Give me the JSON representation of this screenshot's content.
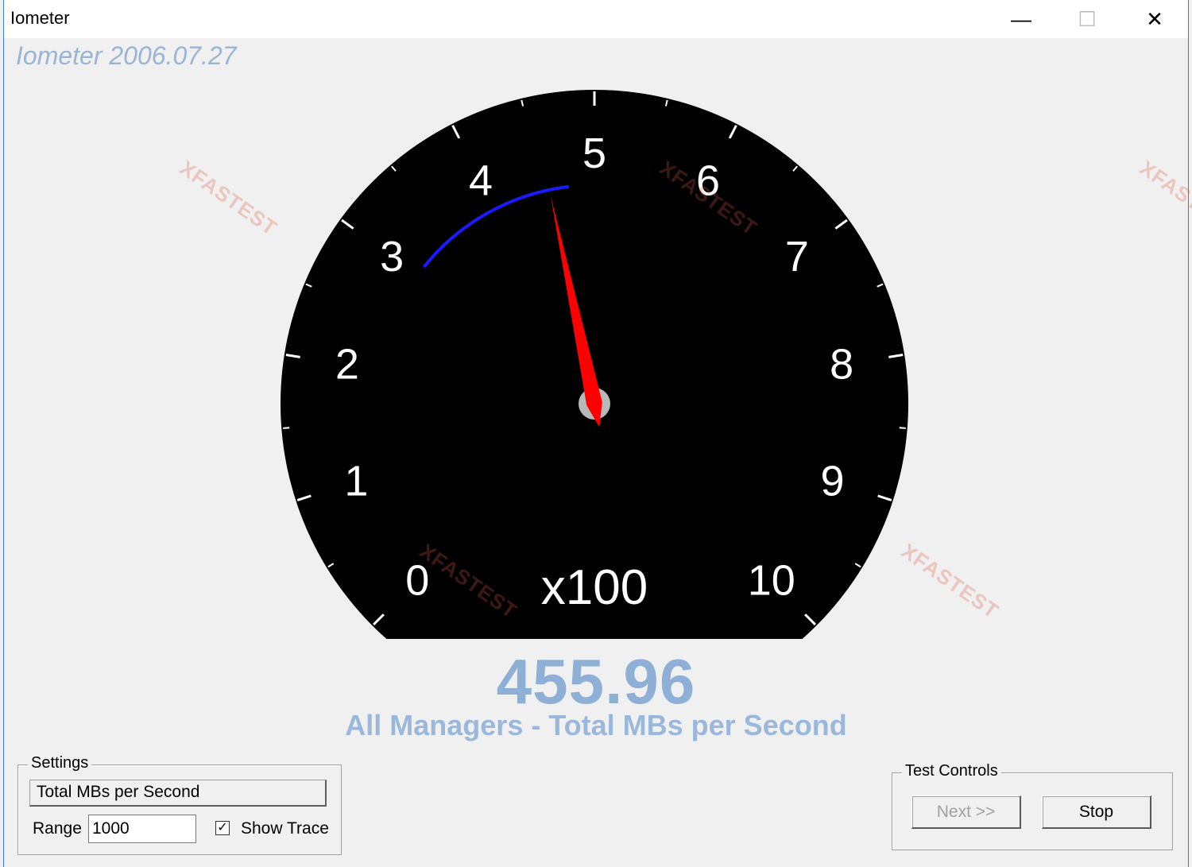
{
  "window": {
    "title": "Iometer",
    "minimize_icon": "minimize-icon",
    "maximize_icon": "maximize-icon",
    "close_icon": "close-icon",
    "minimize_glyph": "—",
    "maximize_glyph": "☐",
    "close_glyph": "✕"
  },
  "app_version": "Iometer 2006.07.27",
  "gauge": {
    "scale_labels": [
      "0",
      "1",
      "2",
      "3",
      "4",
      "5",
      "6",
      "7",
      "8",
      "9",
      "10"
    ],
    "multiplier": "x100",
    "min": 0,
    "max": 1000,
    "current_value": 455.96,
    "trace_range": [
      310,
      475
    ],
    "needle_color": "#ff0000",
    "trace_color": "#1a1aff",
    "face_color": "#000000"
  },
  "readout": {
    "value": "455.96",
    "label": "All Managers - Total MBs per Second"
  },
  "settings": {
    "legend": "Settings",
    "metric_selected": "Total MBs per Second",
    "range_label": "Range",
    "range_value": "1000",
    "show_trace_checked": true,
    "show_trace_mark": "✓",
    "show_trace_label": "Show Trace"
  },
  "test_controls": {
    "legend": "Test Controls",
    "next_label": "Next >>",
    "stop_label": "Stop"
  },
  "watermark": {
    "text": "XFASTEST"
  }
}
